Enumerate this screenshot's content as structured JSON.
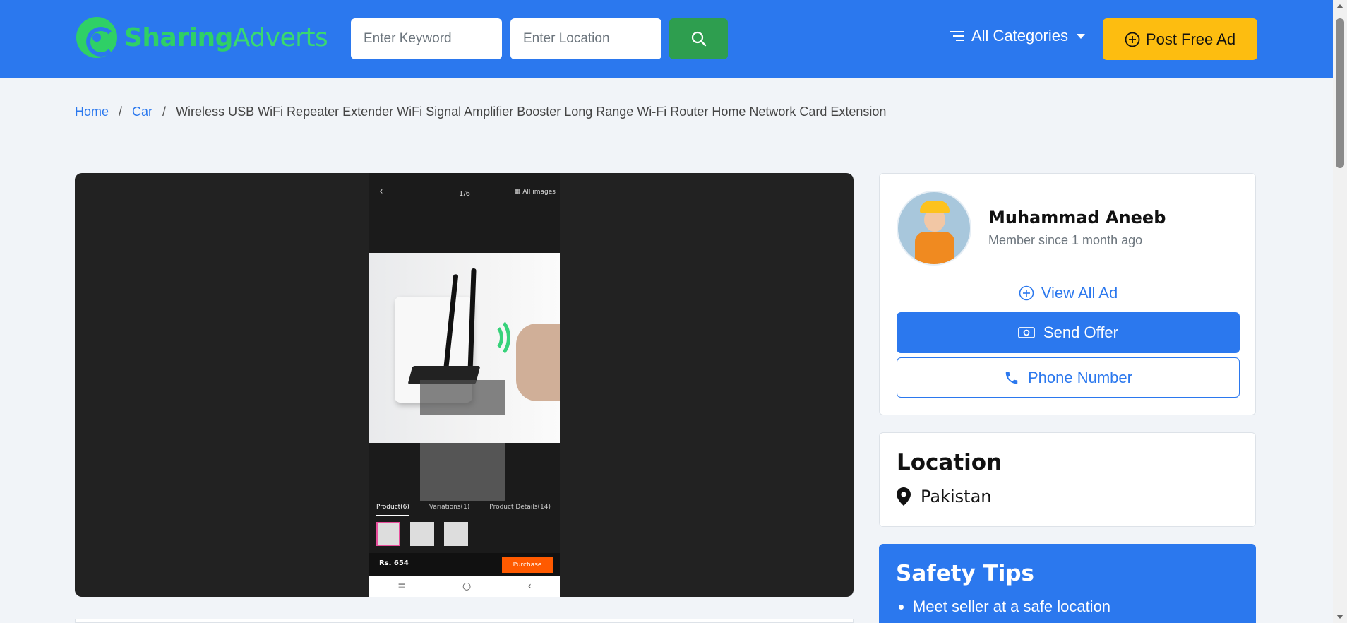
{
  "header": {
    "logo_part1": "Sharing",
    "logo_part2": "Adverts",
    "keyword_placeholder": "Enter Keyword",
    "location_placeholder": "Enter Location",
    "categories_label": "All Categories",
    "post_ad_label": "Post Free Ad",
    "brand_color": "#2b78ee",
    "accent_color": "#fdbd10"
  },
  "breadcrumb": {
    "home": "Home",
    "category": "Car",
    "separator": "/",
    "current": "Wireless USB WiFi Repeater Extender WiFi Signal Amplifier Booster Long Range Wi-Fi Router Home Network Card Extension"
  },
  "gallery": {
    "counter": "1/6",
    "all_images": "All images",
    "tabs": [
      "Product(6)",
      "Variations(1)",
      "Product Details(14)"
    ],
    "price": "Rs. 654",
    "purchase": "Purchase"
  },
  "seller": {
    "name": "Muhammad Aneeb",
    "member_since": "Member since 1 month ago",
    "view_all": "View All Ad",
    "send_offer": "Send Offer",
    "phone_number": "Phone Number"
  },
  "location": {
    "title": "Location",
    "value": "Pakistan"
  },
  "safety": {
    "title": "Safety Tips",
    "tips": [
      "Meet seller at a safe location"
    ]
  }
}
